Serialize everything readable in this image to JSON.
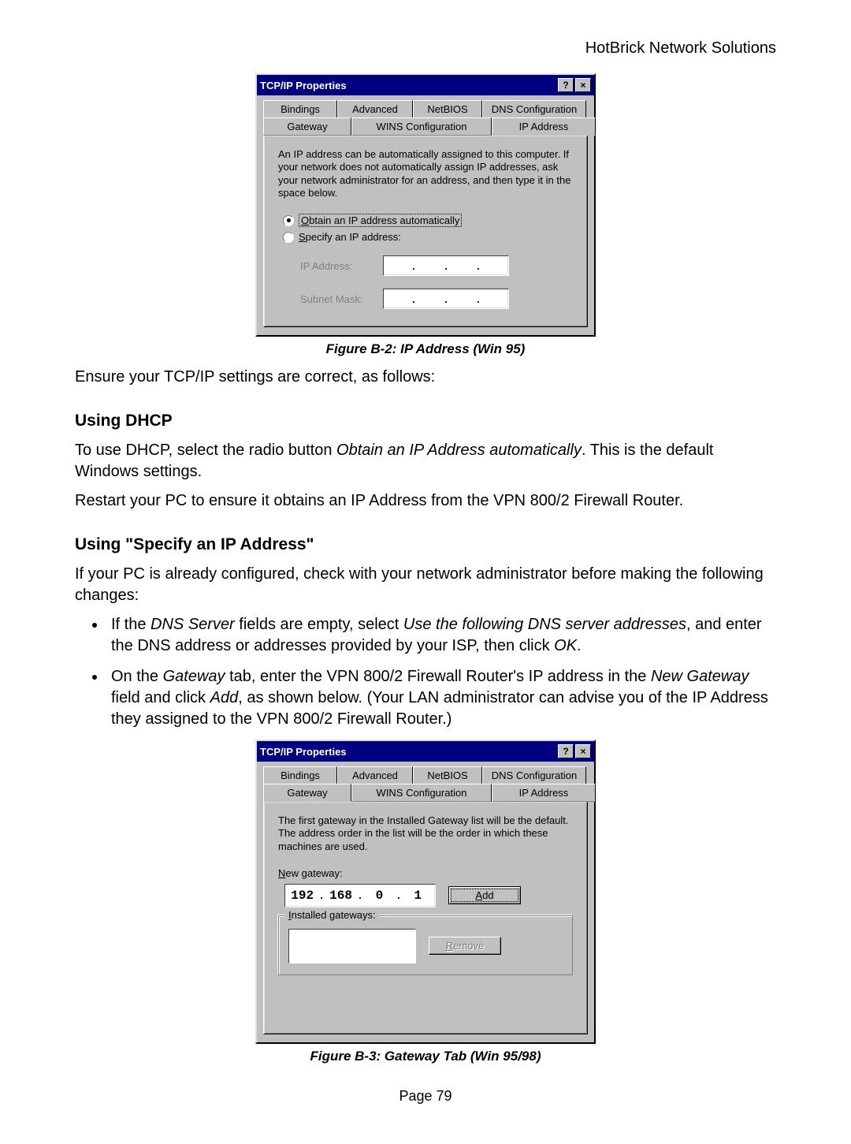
{
  "header": {
    "brand": "HotBrick Network Solutions"
  },
  "figB2": {
    "caption": "Figure B-2: IP Address (Win 95)",
    "title": "TCP/IP Properties",
    "tabs_row1": [
      "Bindings",
      "Advanced",
      "NetBIOS",
      "DNS Configuration"
    ],
    "tabs_row2": [
      "Gateway",
      "WINS Configuration",
      "IP Address"
    ],
    "active_tab": "IP Address",
    "desc": "An IP address can be automatically assigned to this computer.  If your network does not automatically assign IP addresses, ask your network administrator for an address, and then type it in the space below.",
    "radio_auto_prefix": "O",
    "radio_auto_rest": "btain an IP address automatically",
    "radio_spec_prefix": "S",
    "radio_spec_rest": "pecify an IP address:",
    "ip_label": "IP Address:",
    "subnet_label": "Subnet Mask:"
  },
  "text1": "Ensure your TCP/IP settings are correct, as follows:",
  "h_dhcp": "Using DHCP",
  "p_dhcp1_a": "To use DHCP, select the radio button ",
  "p_dhcp1_b": "Obtain an IP Address automatically",
  "p_dhcp1_c": ". This is the default Windows settings.",
  "p_dhcp2": "Restart your PC to ensure it obtains an IP Address from the VPN 800/2 Firewall Router.",
  "h_spec": "Using \"Specify an IP Address\"",
  "p_spec1": "If your PC is already configured, check with your network administrator before making the following changes:",
  "bul1_a": "If the ",
  "bul1_b": "DNS Server",
  "bul1_c": " fields are empty, select ",
  "bul1_d": "Use the following DNS server addresses",
  "bul1_e": ", and enter the DNS address or addresses provided by your ISP, then click ",
  "bul1_f": "OK",
  "bul1_g": ".",
  "bul2_a": "On the ",
  "bul2_b": "Gateway",
  "bul2_c": " tab, enter the VPN 800/2 Firewall Router's IP address in the ",
  "bul2_d": "New Gateway",
  "bul2_e": " field and click ",
  "bul2_f": "Add",
  "bul2_g": ", as shown below. (Your LAN administrator can advise you of the IP Address they assigned to the VPN 800/2 Firewall Router.)",
  "figB3": {
    "caption": "Figure B-3: Gateway Tab (Win 95/98)",
    "title": "TCP/IP Properties",
    "tabs_row1": [
      "Bindings",
      "Advanced",
      "NetBIOS",
      "DNS Configuration"
    ],
    "tabs_row2": [
      "Gateway",
      "WINS Configuration",
      "IP Address"
    ],
    "active_tab": "Gateway",
    "desc": "The first gateway in the Installed Gateway list will be the default. The address order in the list will be the order in which these machines are used.",
    "newgw_prefix": "N",
    "newgw_rest": "ew gateway:",
    "ip": [
      "192",
      "168",
      "0",
      "1"
    ],
    "add_prefix": "A",
    "add_rest": "dd",
    "installed_prefix": "I",
    "installed_rest": "nstalled gateways:",
    "remove_prefix": "R",
    "remove_rest": "emove"
  },
  "page_num": "Page 79"
}
